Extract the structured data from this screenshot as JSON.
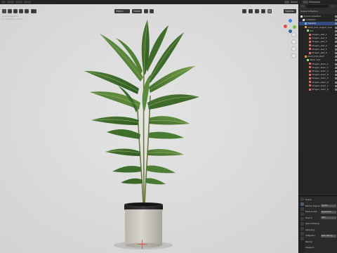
{
  "topbar": {
    "workspace_label": "Scripting",
    "options_label": "Options",
    "view_layer_label": "Scene",
    "render_label": "ViewLayer"
  },
  "viewport": {
    "header": {
      "mode_label": "Object",
      "view_label": "Global",
      "overlay_text_1": "User Perspective",
      "overlay_text_2": "(1) Collection | plant"
    },
    "gizmo_colors": {
      "x": "#e24a4a",
      "y": "#6fbf3a",
      "z": "#3a7fe2"
    }
  },
  "outliner": {
    "title": "Scene Collection",
    "search_placeholder": "",
    "rows": [
      {
        "label": "Scene Collection",
        "indent": 0,
        "icon_color": "#d9d9d9"
      },
      {
        "label": "Collection",
        "indent": 1,
        "icon_color": "#d9d9d9"
      },
      {
        "label": "Camera",
        "indent": 2,
        "icon_color": "#6fb3ff",
        "selected": true
      },
      {
        "label": "plant_014_dragon_tree",
        "indent": 2,
        "icon_color": "#e09a3a"
      },
      {
        "label": "Pot",
        "indent": 3,
        "icon_color": "#7ee27e"
      },
      {
        "label": "Dragon_leaf_1",
        "indent": 4,
        "icon_color": "#e06a6a"
      },
      {
        "label": "Dragon_leaf_2",
        "indent": 4,
        "icon_color": "#e06a6a"
      },
      {
        "label": "Dragon_leaf_3",
        "indent": 4,
        "icon_color": "#e06a6a"
      },
      {
        "label": "Dragon_leaf_4",
        "indent": 4,
        "icon_color": "#e06a6a"
      },
      {
        "label": "Dragon_leaf_5",
        "indent": 4,
        "icon_color": "#e06a6a"
      },
      {
        "label": "Dragon_leaf_6",
        "indent": 4,
        "icon_color": "#e06a6a"
      },
      {
        "label": "plant_014_stem",
        "indent": 2,
        "icon_color": "#e09a3a"
      },
      {
        "label": "Stem mat",
        "indent": 3,
        "icon_color": "#7ee27e"
      },
      {
        "label": "Dragon_stem_1",
        "indent": 4,
        "icon_color": "#e06a6a"
      },
      {
        "label": "Dragon_stem_2",
        "indent": 4,
        "icon_color": "#e06a6a"
      },
      {
        "label": "Dragon_stem_3",
        "indent": 4,
        "icon_color": "#e06a6a"
      },
      {
        "label": "Dragon_stem_4",
        "indent": 4,
        "icon_color": "#e06a6a"
      },
      {
        "label": "Dragon_stem_5",
        "indent": 4,
        "icon_color": "#e06a6a"
      },
      {
        "label": "Dragon_stem_6",
        "indent": 4,
        "icon_color": "#e06a6a"
      },
      {
        "label": "Dragon_stem_7",
        "indent": 4,
        "icon_color": "#e06a6a"
      },
      {
        "label": "Dragon_stem_8",
        "indent": 4,
        "icon_color": "#e06a6a"
      }
    ]
  },
  "properties": {
    "title": "Scene",
    "rows": [
      {
        "label": "Scene",
        "value": ""
      },
      {
        "label": "Render Engine",
        "value": "Cycles"
      },
      {
        "label": "Feature Set",
        "value": "Supported"
      },
      {
        "label": "Device",
        "value": "GPU"
      },
      {
        "label": "Open Shading",
        "value": ""
      },
      {
        "label": "Sampling",
        "value": ""
      },
      {
        "label": "Integrator",
        "value": "Path Tracing"
      },
      {
        "label": "Render",
        "value": ""
      },
      {
        "label": "Viewport",
        "value": ""
      }
    ]
  }
}
